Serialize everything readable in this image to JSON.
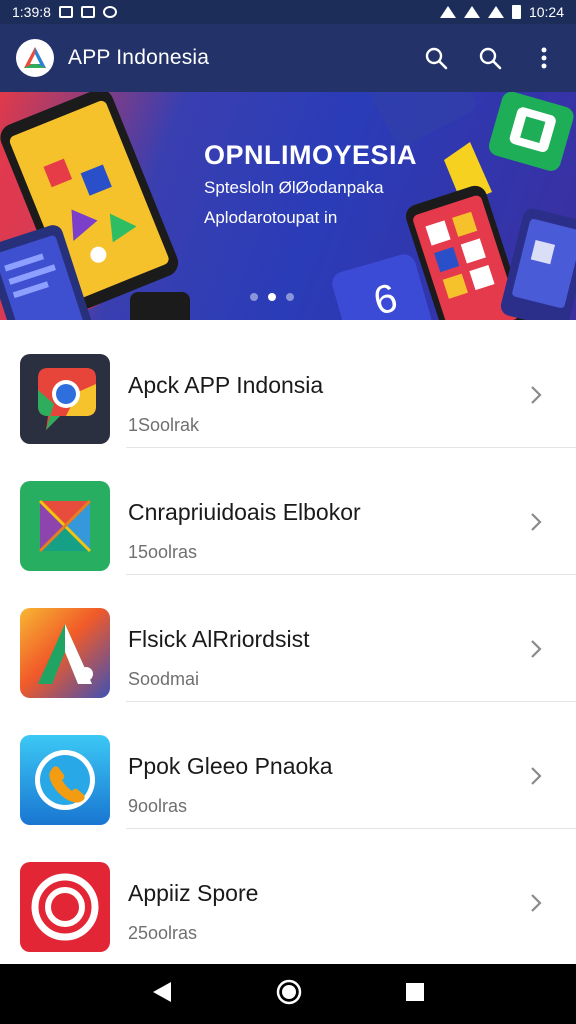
{
  "status_bar": {
    "time_left": "1:39:8",
    "time_right": "10:24"
  },
  "app_bar": {
    "title": "APP Indonesia",
    "icons": [
      "search-icon",
      "search-icon",
      "more-vert-icon"
    ]
  },
  "banner": {
    "headline": "OPNLIMOYESIA",
    "subtitle_1": "Sptesloln ØlØodanpaka",
    "subtitle_2": "Aplodarotoupat in",
    "slide_count": 3,
    "active_slide": 2
  },
  "apps": [
    {
      "name": "Apck APP Indonsia",
      "meta": "1Soolrak",
      "icon": "chrome-icon"
    },
    {
      "name": "Cnrapriuidoais Elbokor",
      "meta": "15oolras",
      "icon": "cube-icon"
    },
    {
      "name": "Flsick AlRriordsist",
      "meta": "Soodmai",
      "icon": "letter-a-icon"
    },
    {
      "name": "Ppok Gleeo Pnaoka",
      "meta": "9oolras",
      "icon": "phone-icon"
    },
    {
      "name": "Appiiz Spore",
      "meta": "25oolras",
      "icon": "target-icon"
    }
  ],
  "nav_bar": {
    "icons": [
      "back-icon",
      "home-icon",
      "recents-icon"
    ]
  },
  "colors": {
    "app_bar": "#23336a",
    "status_bar": "#1d2d5a"
  }
}
